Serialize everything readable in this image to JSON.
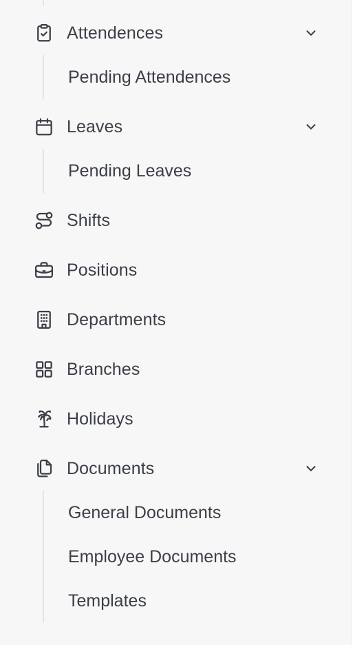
{
  "nav": {
    "attendences": {
      "label": "Attendences",
      "icon": "clipboard-check-icon",
      "children": [
        "Pending Attendences"
      ]
    },
    "leaves": {
      "label": "Leaves",
      "icon": "calendar-icon",
      "children": [
        "Pending Leaves"
      ]
    },
    "shifts": {
      "label": "Shifts",
      "icon": "route-icon"
    },
    "positions": {
      "label": "Positions",
      "icon": "briefcase-icon"
    },
    "departments": {
      "label": "Departments",
      "icon": "building-icon"
    },
    "branches": {
      "label": "Branches",
      "icon": "grid-icon"
    },
    "holidays": {
      "label": "Holidays",
      "icon": "palm-tree-icon"
    },
    "documents": {
      "label": "Documents",
      "icon": "files-icon",
      "children": [
        "General Documents",
        "Employee Documents",
        "Templates"
      ]
    }
  },
  "colors": {
    "background": "#f7f7f8",
    "text": "#3b3f46",
    "line": "#e4e4e7"
  }
}
